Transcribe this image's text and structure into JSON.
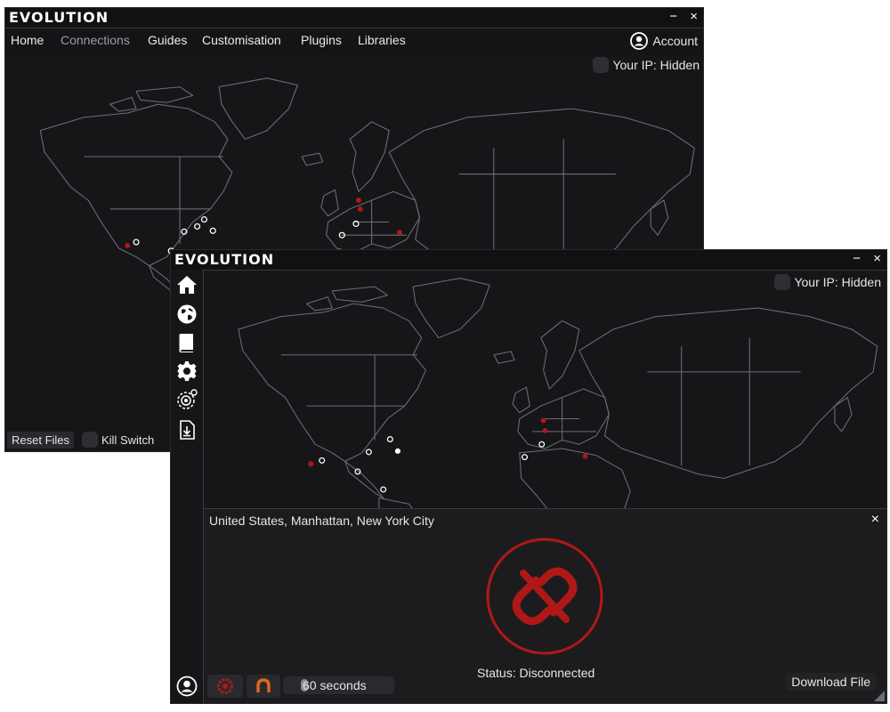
{
  "back_window": {
    "logo": "EVOLUTION",
    "minimize": "−",
    "close": "×",
    "nav": [
      "Home",
      "Connections",
      "Guides",
      "Customisation",
      "Plugins",
      "Libraries"
    ],
    "active_nav": "Connections",
    "account_label": "Account",
    "ip_label": "Your IP: Hidden",
    "reset_files": "Reset Files",
    "kill_switch": "Kill Switch"
  },
  "front_window": {
    "logo": "EVOLUTION",
    "minimize": "−",
    "close": "×",
    "ip_label": "Your IP: Hidden",
    "sidebar_icons": [
      "home-icon",
      "globe-icon",
      "book-icon",
      "settings-icon",
      "plugins-icon",
      "libraries-icon",
      "account-icon"
    ],
    "location": "United States, Manhattan, New York City",
    "panel_close": "×",
    "status": "Status: Disconnected",
    "download_file": "Download File",
    "timer_value": "60 seconds"
  },
  "colors": {
    "background": "#161618",
    "accent_red": "#b01818",
    "orange": "#e0651e",
    "text": "#e6e6e6"
  }
}
